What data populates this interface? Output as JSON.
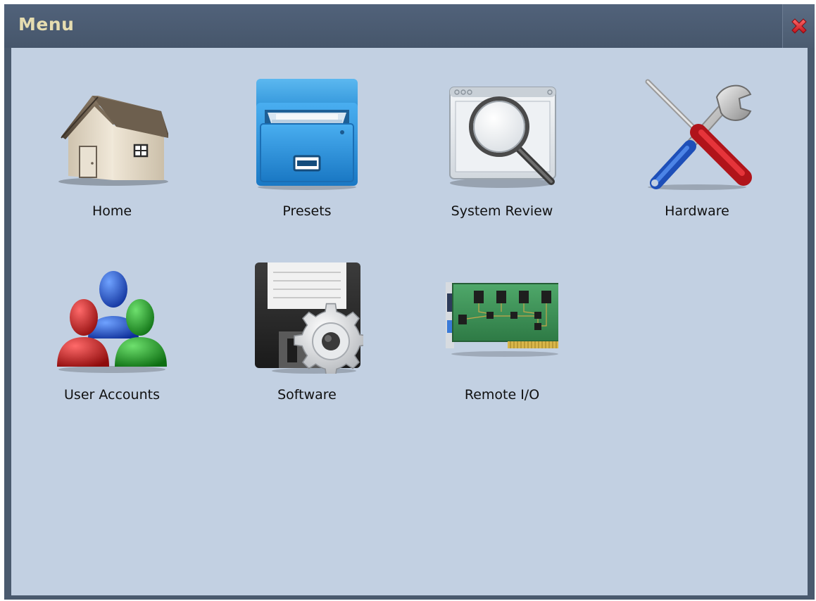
{
  "window": {
    "title": "Menu",
    "close_icon": "close-x-icon"
  },
  "colors": {
    "titlebar": "#4a5a6e",
    "title_text": "#e6ddb0",
    "content_bg": "#c2d0e2",
    "close_x": "#e0202a"
  },
  "menu": {
    "items": [
      {
        "label": "Home",
        "icon": "house-icon"
      },
      {
        "label": "Presets",
        "icon": "file-cabinet-icon"
      },
      {
        "label": "System Review",
        "icon": "magnifier-icon"
      },
      {
        "label": "Hardware",
        "icon": "tools-icon"
      },
      {
        "label": "User Accounts",
        "icon": "users-icon"
      },
      {
        "label": "Software",
        "icon": "floppy-gear-icon"
      },
      {
        "label": "Remote I/O",
        "icon": "circuit-board-icon"
      }
    ]
  }
}
